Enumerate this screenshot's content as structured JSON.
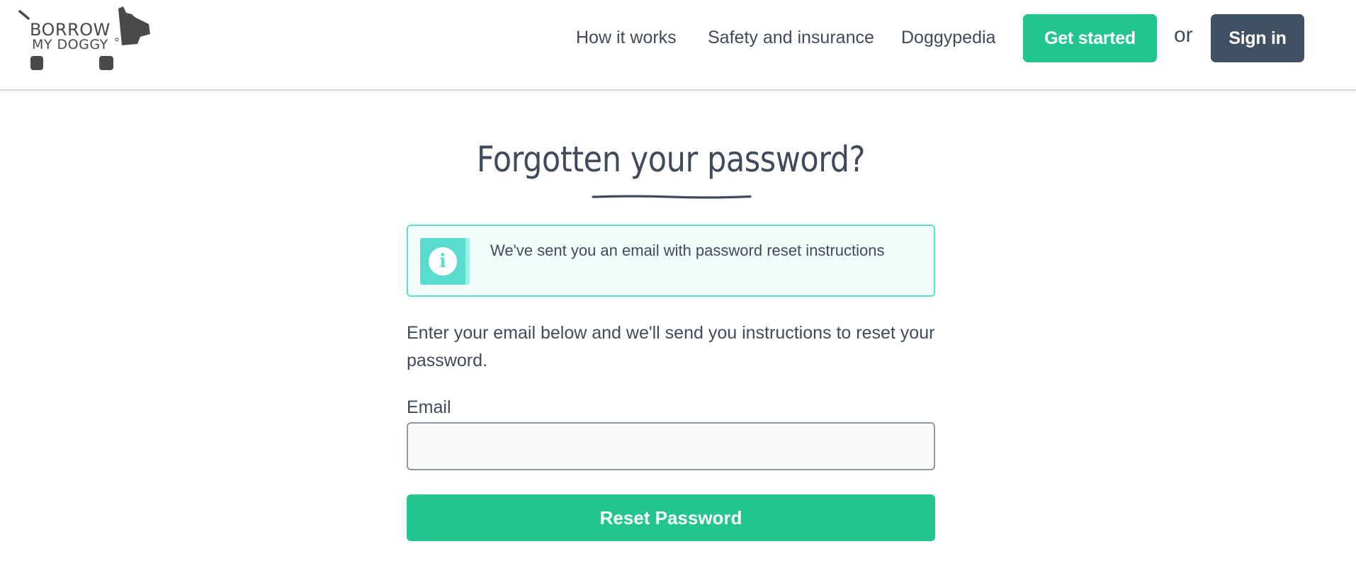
{
  "header": {
    "logo": {
      "line1": "BORROW",
      "line2": "MY DOGGY",
      "icon": "dog-logo-icon"
    },
    "nav": {
      "links": [
        {
          "label": "How it works"
        },
        {
          "label": "Safety and insurance"
        },
        {
          "label": "Doggypedia"
        }
      ],
      "get_started_label": "Get started",
      "or_text": "or",
      "sign_in_label": "Sign in"
    }
  },
  "main": {
    "title": "Forgotten your password?",
    "alert": {
      "icon": "info-icon",
      "icon_glyph": "i",
      "message": "We've sent you an email with password reset instructions"
    },
    "instructions": "Enter your email below and we'll send you instructions to reset your password.",
    "email": {
      "label": "Email",
      "value": "",
      "placeholder": ""
    },
    "reset_button_label": "Reset Password"
  },
  "colors": {
    "accent_green": "#22c58c",
    "dark_slate": "#425064",
    "text": "#3f4b5c",
    "info_teal": "#5adbd0",
    "info_border": "#5edfd3"
  }
}
